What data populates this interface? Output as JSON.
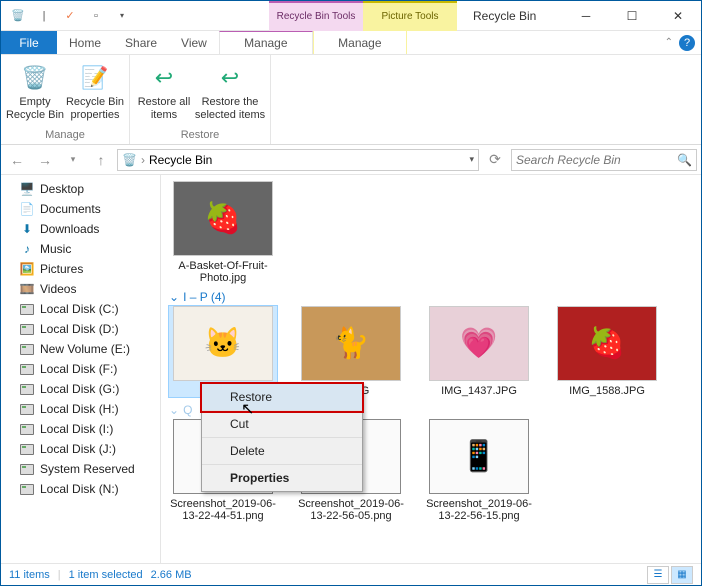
{
  "window": {
    "title": "Recycle Bin",
    "contextual_tabs": [
      {
        "label": "Recycle Bin Tools",
        "sub": "Manage"
      },
      {
        "label": "Picture Tools",
        "sub": "Manage"
      }
    ]
  },
  "menubar": {
    "file": "File",
    "tabs": [
      "Home",
      "Share",
      "View"
    ],
    "manage_pink": "Manage",
    "manage_yellow": "Manage"
  },
  "ribbon": {
    "groups": [
      {
        "label": "Manage",
        "buttons": [
          {
            "text": "Empty Recycle Bin"
          },
          {
            "text": "Recycle Bin properties"
          }
        ]
      },
      {
        "label": "Restore",
        "buttons": [
          {
            "text": "Restore all items"
          },
          {
            "text": "Restore the selected items"
          }
        ]
      }
    ]
  },
  "address": {
    "path": "Recycle Bin",
    "search_placeholder": "Search Recycle Bin"
  },
  "tree": [
    "Desktop",
    "Documents",
    "Downloads",
    "Music",
    "Pictures",
    "Videos",
    "Local Disk (C:)",
    "Local Disk (D:)",
    "New Volume (E:)",
    "Local Disk (F:)",
    "Local Disk (G:)",
    "Local Disk (H:)",
    "Local Disk (I:)",
    "Local Disk (J:)",
    "System Reserved",
    "Local Disk (N:)"
  ],
  "files": {
    "group_a": [
      {
        "name": "A-Basket-Of-Fruit-Photo.jpg"
      }
    ],
    "group_i_header": "I – P (4)",
    "group_i": [
      {
        "name": "",
        "selected": true
      },
      {
        "name": "02.JPG"
      },
      {
        "name": "IMG_1437.JPG"
      },
      {
        "name": "IMG_1588.JPG"
      }
    ],
    "group_s": [
      {
        "name": "Screenshot_2019-06-13-22-44-51.png"
      },
      {
        "name": "Screenshot_2019-06-13-22-56-05.png"
      },
      {
        "name": "Screenshot_2019-06-13-22-56-15.png"
      }
    ]
  },
  "context_menu": {
    "items": [
      "Restore",
      "Cut",
      "Delete",
      "Properties"
    ]
  },
  "status": {
    "count": "11 items",
    "selection": "1 item selected",
    "size": "2.66 MB"
  }
}
